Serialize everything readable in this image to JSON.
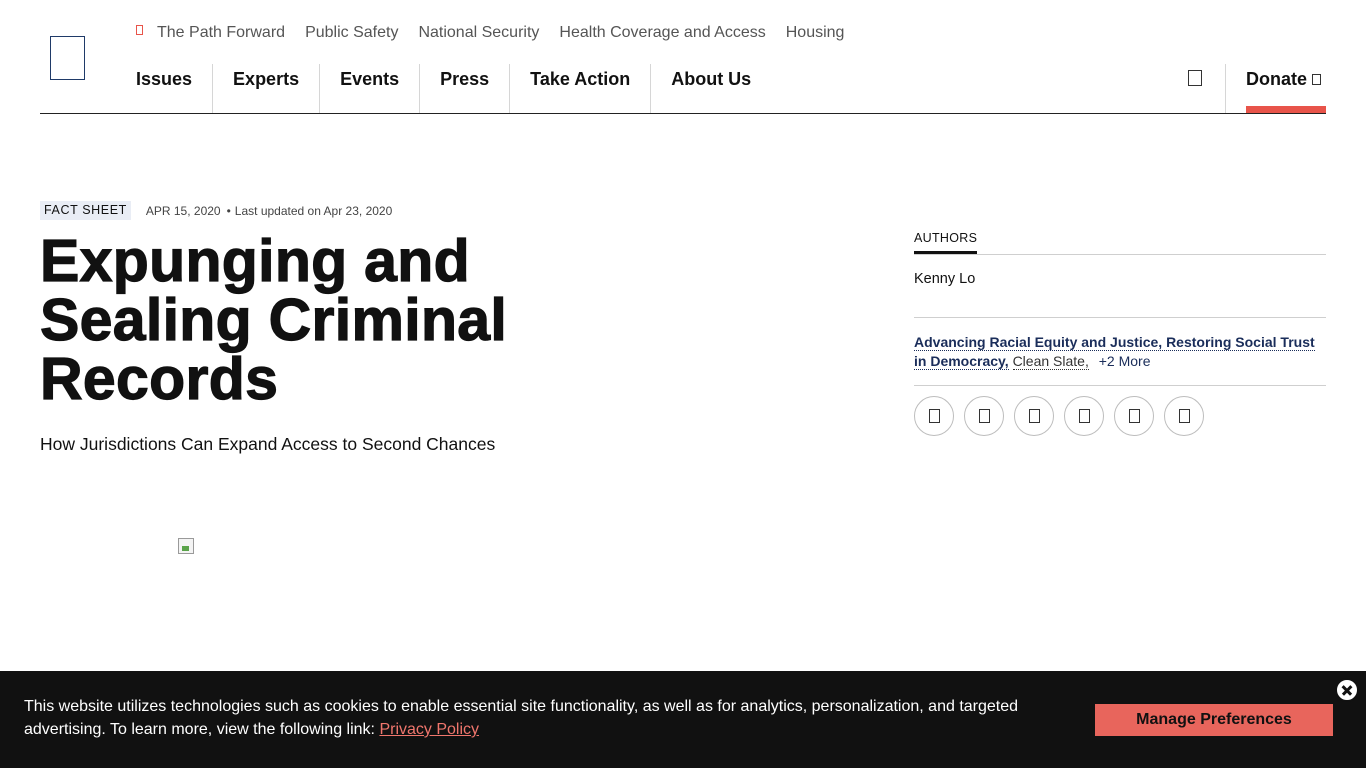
{
  "header": {
    "top_nav": [
      "The Path Forward",
      "Public Safety",
      "National Security",
      "Health Coverage and Access",
      "Housing"
    ],
    "main_nav": [
      "Issues",
      "Experts",
      "Events",
      "Press",
      "Take Action",
      "About Us"
    ],
    "donate_label": "Donate",
    "accent_color": "#e8544a"
  },
  "article": {
    "tag": "FACT SHEET",
    "date": "APR 15, 2020",
    "separator": "•",
    "updated": "Last updated on Apr 23, 2020",
    "title": "Expunging and Sealing Criminal Records",
    "subtitle": "How Jurisdictions Can Expand Access to Second Chances"
  },
  "sidebar": {
    "authors_label": "AUTHORS",
    "author": "Kenny Lo",
    "topics_strong": "Advancing Racial Equity and Justice, Restoring Social Trust in Democracy,",
    "topics_plain": "Clean Slate,",
    "topics_more": "+2 More",
    "share_icons": [
      "share-icon-1",
      "share-icon-2",
      "share-icon-3",
      "share-icon-4",
      "share-icon-5",
      "share-icon-6"
    ]
  },
  "cookie_banner": {
    "text": "This website utilizes technologies such as cookies to enable essential site functionality, as well as for analytics, personalization, and targeted advertising. To learn more, view the following link:",
    "link_label": "Privacy Policy",
    "button_label": "Manage Preferences"
  }
}
